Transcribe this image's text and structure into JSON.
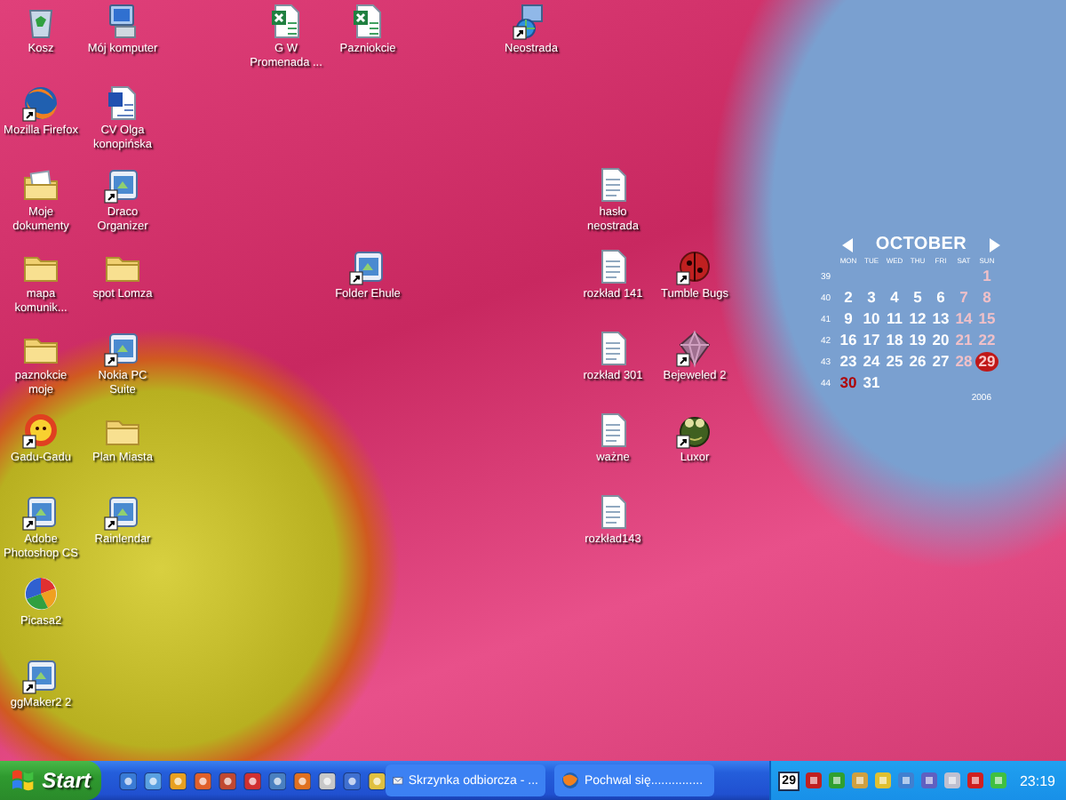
{
  "desktop": {
    "icons": [
      {
        "label": "Kosz",
        "kind": "recycle-bin",
        "shortcut": false
      },
      {
        "label": "Mój komputer",
        "kind": "computer",
        "shortcut": false
      },
      {
        "label": "G W Promenada ...",
        "kind": "spreadsheet",
        "shortcut": false
      },
      {
        "label": "Pazniokcie",
        "kind": "spreadsheet",
        "shortcut": false
      },
      {
        "label": "Neostrada",
        "kind": "network",
        "shortcut": true
      },
      {
        "label": "Mozilla Firefox",
        "kind": "browser",
        "shortcut": true
      },
      {
        "label": "CV Olga konopińska",
        "kind": "word-document",
        "shortcut": false
      },
      {
        "label": "Moje dokumenty",
        "kind": "documents-folder",
        "shortcut": false
      },
      {
        "label": "Draco Organizer",
        "kind": "program",
        "shortcut": true
      },
      {
        "label": "hasło neostrada",
        "kind": "text-file",
        "shortcut": false
      },
      {
        "label": "mapa komunik...",
        "kind": "folder",
        "shortcut": false
      },
      {
        "label": "spot Lomza",
        "kind": "folder",
        "shortcut": false
      },
      {
        "label": "Folder Ehule",
        "kind": "program",
        "shortcut": true
      },
      {
        "label": "rozkład 141",
        "kind": "text-file",
        "shortcut": false
      },
      {
        "label": "Tumble Bugs",
        "kind": "ladybug",
        "shortcut": true
      },
      {
        "label": "paznokcie moje",
        "kind": "folder",
        "shortcut": false
      },
      {
        "label": "Nokia PC Suite",
        "kind": "program",
        "shortcut": true
      },
      {
        "label": "rozkład 301",
        "kind": "text-file",
        "shortcut": false
      },
      {
        "label": "Bejeweled 2",
        "kind": "gem",
        "shortcut": true
      },
      {
        "label": "Gadu-Gadu",
        "kind": "flower",
        "shortcut": true
      },
      {
        "label": "Plan Miasta",
        "kind": "folder",
        "shortcut": false
      },
      {
        "label": "ważne",
        "kind": "text-file",
        "shortcut": false
      },
      {
        "label": "Luxor",
        "kind": "frog",
        "shortcut": true
      },
      {
        "label": "Adobe Photoshop CS",
        "kind": "program",
        "shortcut": true
      },
      {
        "label": "Rainlendar",
        "kind": "program",
        "shortcut": true
      },
      {
        "label": "rozkład143",
        "kind": "text-file",
        "shortcut": false
      },
      {
        "label": "Picasa2",
        "kind": "picasa",
        "shortcut": false
      },
      {
        "label": "ggMaker2 2",
        "kind": "program",
        "shortcut": true
      }
    ]
  },
  "calendar": {
    "month": "OCTOBER",
    "year": "2006",
    "weekdays": [
      "MON",
      "TUE",
      "WED",
      "THU",
      "FRI",
      "SAT",
      "SUN"
    ],
    "weeks": [
      {
        "number": "39",
        "days": [
          {
            "day": "1",
            "today": false,
            "marked": false
          }
        ]
      },
      {
        "number": "40",
        "days": [
          {
            "day": "2",
            "today": false,
            "marked": false
          },
          {
            "day": "3",
            "today": false,
            "marked": false
          },
          {
            "day": "4",
            "today": false,
            "marked": false
          },
          {
            "day": "5",
            "today": false,
            "marked": false
          },
          {
            "day": "6",
            "today": false,
            "marked": false
          },
          {
            "day": "7",
            "today": false,
            "marked": false
          },
          {
            "day": "8",
            "today": false,
            "marked": false
          }
        ]
      },
      {
        "number": "41",
        "days": [
          {
            "day": "9",
            "today": false,
            "marked": false
          },
          {
            "day": "10",
            "today": false,
            "marked": false
          },
          {
            "day": "11",
            "today": false,
            "marked": false
          },
          {
            "day": "12",
            "today": false,
            "marked": false
          },
          {
            "day": "13",
            "today": false,
            "marked": false
          },
          {
            "day": "14",
            "today": false,
            "marked": false
          },
          {
            "day": "15",
            "today": false,
            "marked": false
          }
        ]
      },
      {
        "number": "42",
        "days": [
          {
            "day": "16",
            "today": false,
            "marked": false
          },
          {
            "day": "17",
            "today": false,
            "marked": false
          },
          {
            "day": "18",
            "today": false,
            "marked": false
          },
          {
            "day": "19",
            "today": false,
            "marked": false
          },
          {
            "day": "20",
            "today": false,
            "marked": false
          },
          {
            "day": "21",
            "today": false,
            "marked": false
          },
          {
            "day": "22",
            "today": false,
            "marked": false
          }
        ]
      },
      {
        "number": "43",
        "days": [
          {
            "day": "23",
            "today": false,
            "marked": false
          },
          {
            "day": "24",
            "today": false,
            "marked": false
          },
          {
            "day": "25",
            "today": false,
            "marked": false
          },
          {
            "day": "26",
            "today": false,
            "marked": false
          },
          {
            "day": "27",
            "today": false,
            "marked": false
          },
          {
            "day": "28",
            "today": false,
            "marked": false
          },
          {
            "day": "29",
            "today": true,
            "marked": false
          }
        ]
      },
      {
        "number": "44",
        "days": [
          {
            "day": "30",
            "today": false,
            "marked": true
          },
          {
            "day": "31",
            "today": false,
            "marked": false
          }
        ]
      }
    ]
  },
  "taskbar": {
    "start_label": "Start",
    "tasks": [
      {
        "label": "Skrzynka odbiorcza - ...",
        "kind": "mail",
        "active": false
      },
      {
        "label": "Pochwal się...............",
        "kind": "browser",
        "active": false
      }
    ],
    "tray": {
      "calendar_day": "29",
      "clock": "23:19"
    }
  }
}
